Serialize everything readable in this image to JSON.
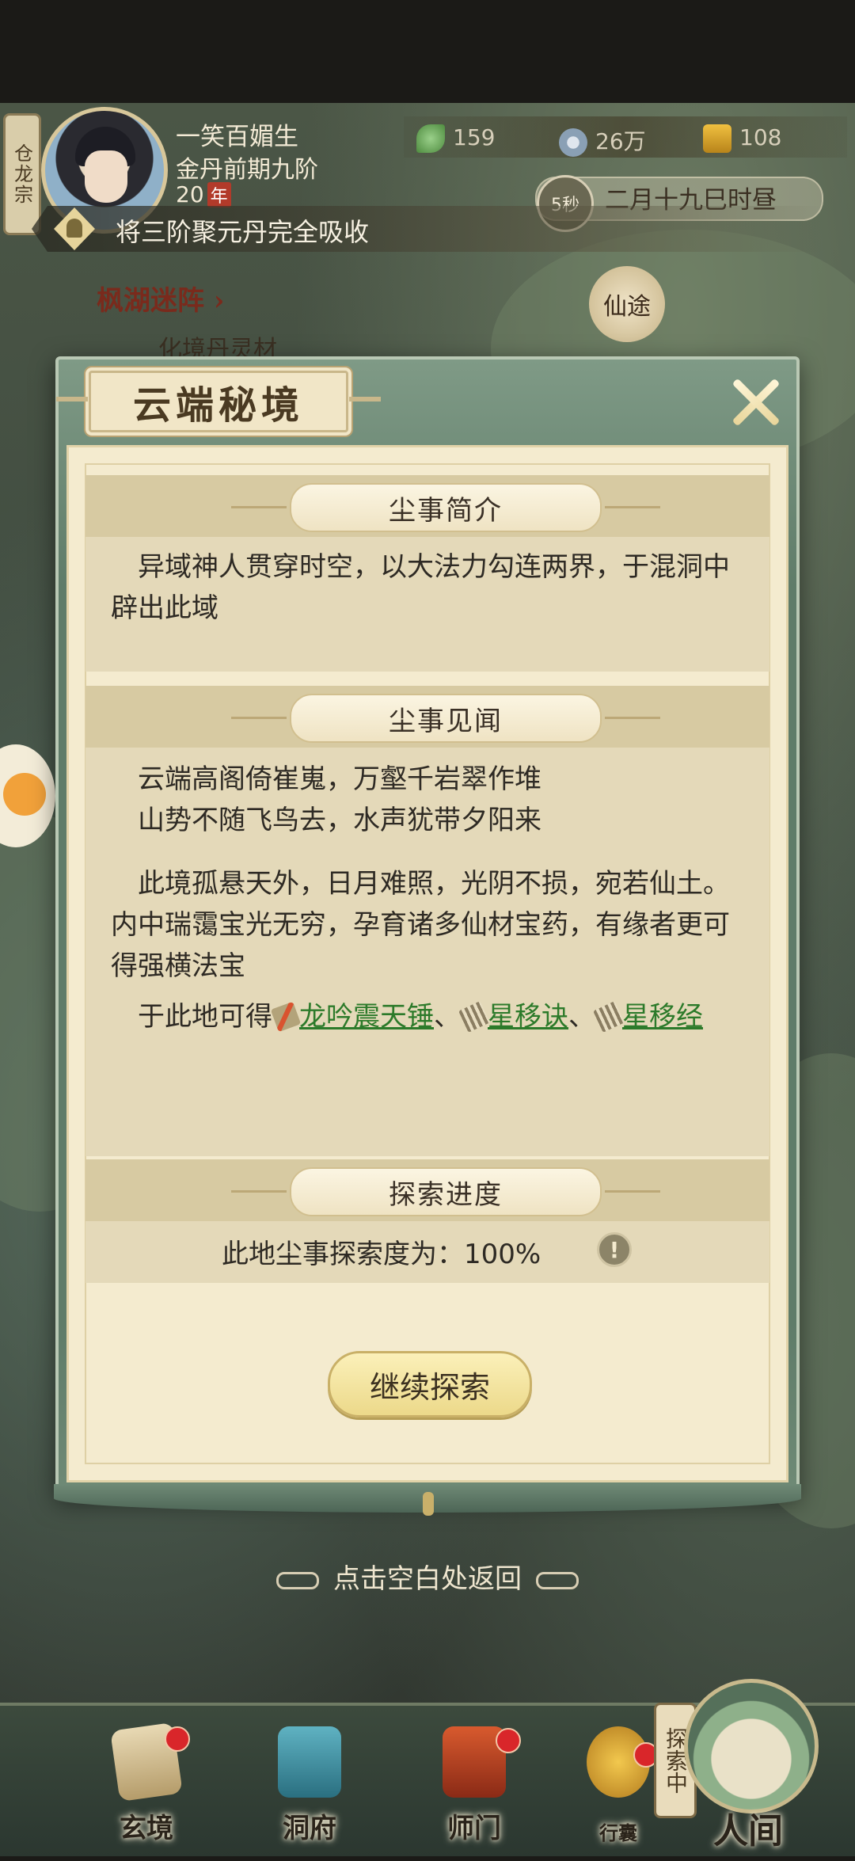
{
  "hud": {
    "sect": "仓龙宗",
    "player_name": "一笑百媚生",
    "player_rank": "金丹前期九阶",
    "player_age": "20",
    "age_unit": "年",
    "resources": [
      {
        "icon": "jade-icon",
        "value": "159"
      },
      {
        "icon": "coin-icon",
        "value": "26万"
      },
      {
        "icon": "gold-icon",
        "value": "108"
      }
    ],
    "timer": "5秒",
    "game_time": "二月十九巳时昼",
    "notice": "将三阶聚元丹完全吸收"
  },
  "map": {
    "location_label": "枫湖迷阵 ›",
    "location_sub": "化境丹灵材",
    "xian_badge": "仙途"
  },
  "modal": {
    "title": "云端秘境",
    "sections": {
      "intro_title": "尘事简介",
      "intro_text": "异域神人贯穿时空，以大法力勾连两界，于混洞中辟出此域",
      "lore_title": "尘事见闻",
      "poem_line1": "云端高阁倚崔嵬，万壑千岩翠作堆",
      "poem_line2": "山势不随飞鸟去，水声犹带夕阳来",
      "lore_text": "此境孤悬天外，日月难照，光阴不损，宛若仙土。内中瑞霭宝光无穷，孕育诸多仙材宝药，有缘者更可得强横法宝",
      "rewards_prefix": "于此地可得",
      "rewards": [
        "龙吟震天锤",
        "星移诀",
        "星移经"
      ],
      "separator": "、",
      "progress_title": "探索进度",
      "progress_text": "此地尘事探索度为：100%"
    },
    "continue_label": "继续探索",
    "back_hint": "点击空白处返回"
  },
  "nav": {
    "items": [
      "玄境",
      "洞府",
      "师门",
      "行囊",
      "人间"
    ],
    "explore_tag": "探索中"
  },
  "colors": {
    "link": "#2c7a2a",
    "paper": "#f4ebcf",
    "frame": "#5f7c69",
    "button": "#ecd98a"
  }
}
